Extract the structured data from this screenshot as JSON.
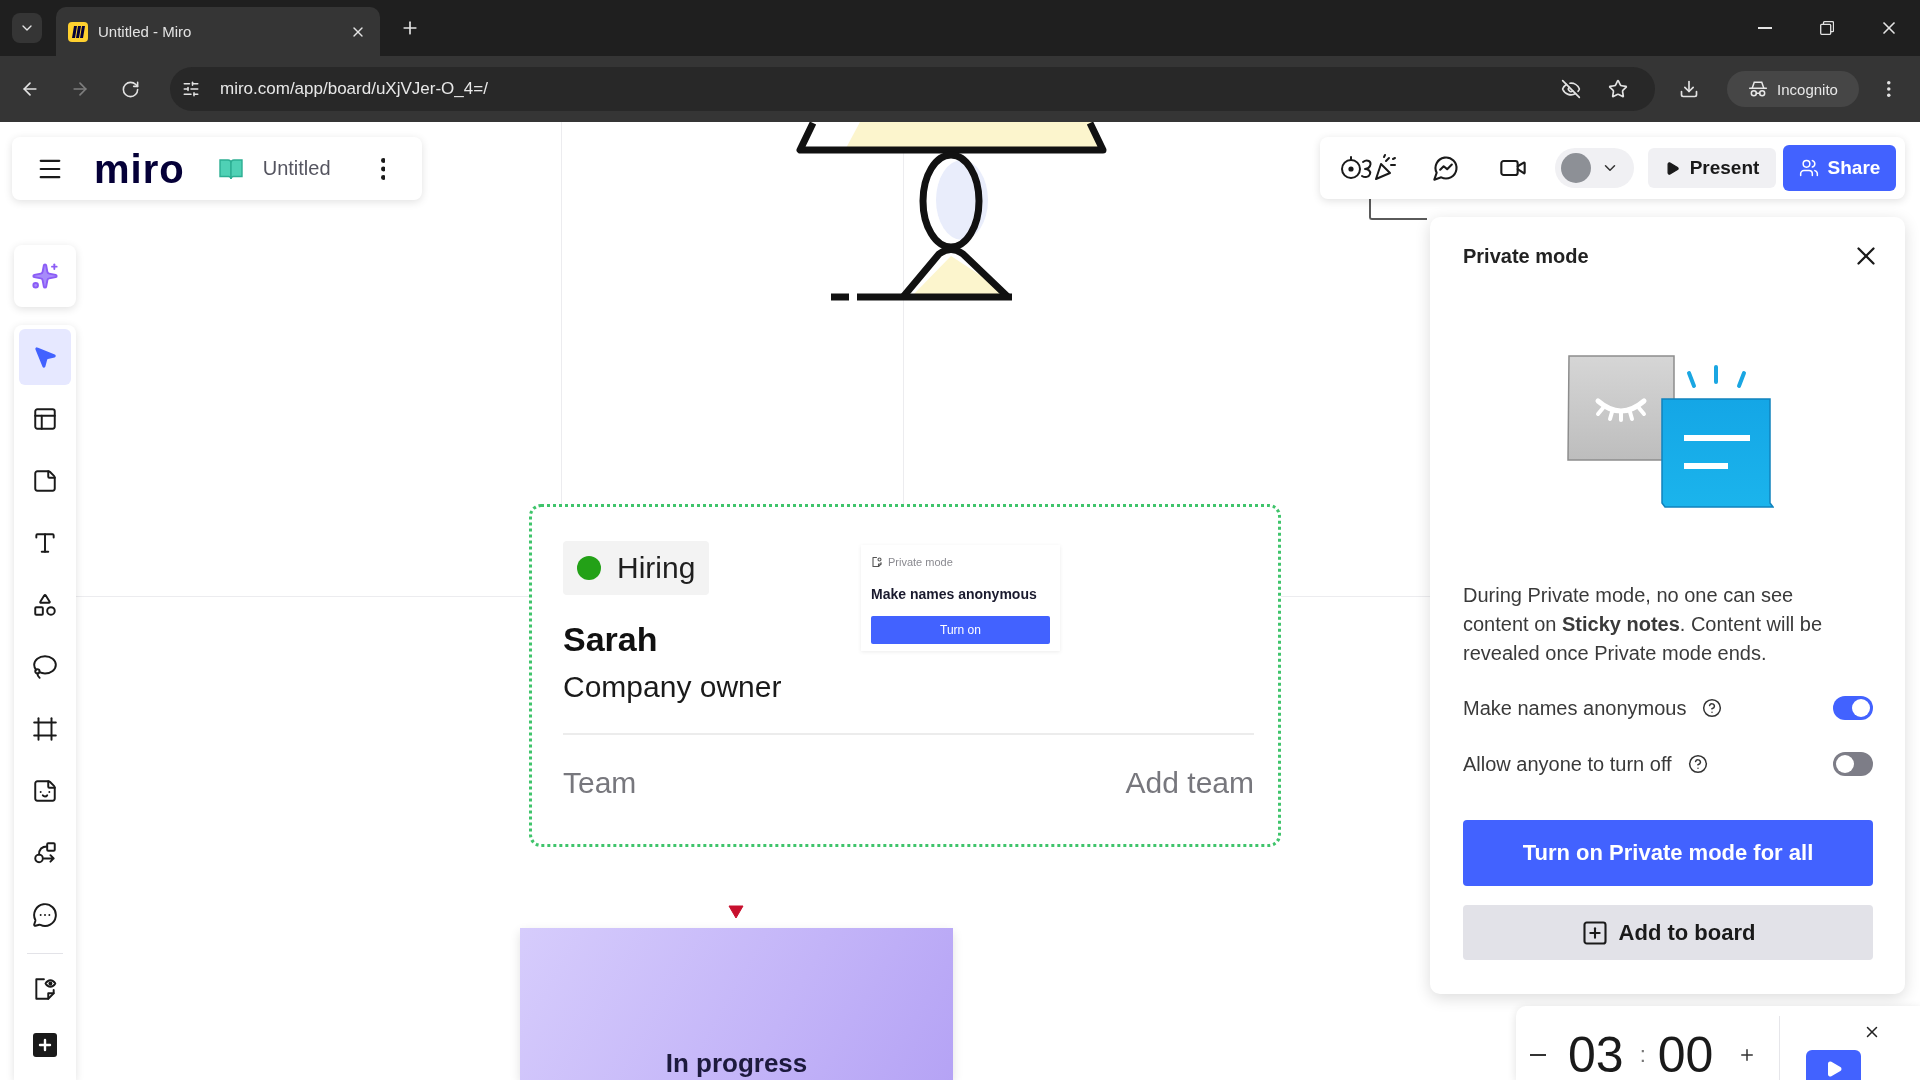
{
  "browser": {
    "tab_title": "Untitled - Miro",
    "url": "miro.com/app/board/uXjVJer-O_4=/",
    "forward_disabled": true,
    "profile_label": "Incognito"
  },
  "board_header": {
    "logo": "miro",
    "board_name": "Untitled"
  },
  "left_toolbar": {
    "tools": [
      {
        "selected": true
      },
      {
        "selected": false
      },
      {
        "selected": false
      },
      {
        "selected": false
      },
      {
        "selected": false
      },
      {
        "selected": false
      },
      {
        "selected": false
      },
      {
        "selected": false
      },
      {
        "selected": false
      },
      {
        "selected": false
      }
    ]
  },
  "top_toolbar": {
    "present_label": "Present",
    "share_label": "Share"
  },
  "canvas": {
    "card": {
      "status": "Hiring",
      "name": "Sarah",
      "role": "Company owner",
      "field_label": "Team",
      "field_value": "Add team"
    },
    "preview": {
      "title": "Private mode",
      "heading": "Make names anonymous",
      "button": "Turn on"
    },
    "sticky_note": {
      "text": "In progress"
    }
  },
  "private_mode_panel": {
    "title": "Private mode",
    "description": "During Private mode, no one can see content on **Sticky notes**. Content will be revealed once Private mode ends.",
    "options": [
      {
        "label": "Make names anonymous",
        "on": true
      },
      {
        "label": "Allow anyone to turn off",
        "on": false
      }
    ],
    "primary_button": "Turn on Private mode for all",
    "secondary_button": "Add to board"
  },
  "timer": {
    "minutes": "03",
    "separator": ":",
    "seconds": "00"
  }
}
